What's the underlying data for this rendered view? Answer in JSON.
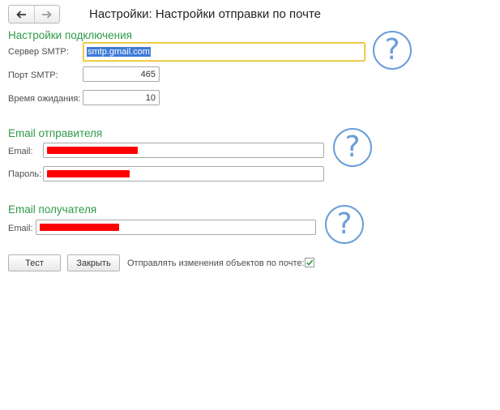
{
  "page": {
    "title": "Настройки: Настройки отправки по почте"
  },
  "nav": {
    "back_icon": "arrow-left-icon",
    "forward_icon": "arrow-right-icon"
  },
  "connection": {
    "title": "Настройки подключения",
    "smtp_server_label": "Сервер SMTP:",
    "smtp_server_value": "smtp.gmail.com",
    "smtp_port_label": "Порт SMTP:",
    "smtp_port_value": "465",
    "timeout_label": "Время ожидания:",
    "timeout_value": "10",
    "help_icon": "question-circle-icon"
  },
  "sender": {
    "title": "Email отправителя",
    "email_label": "Email:",
    "password_label": "Пароль:",
    "email_value_state": "redacted",
    "password_value_state": "redacted",
    "help_icon": "question-circle-icon"
  },
  "recipient": {
    "title": "Email получателя",
    "email_label": "Email:",
    "email_value_state": "redacted",
    "help_icon": "question-circle-icon"
  },
  "footer": {
    "test_button": "Тест",
    "close_button": "Закрыть",
    "send_changes_label": "Отправлять изменения объектов по почте:",
    "send_changes_checked": true
  },
  "colors": {
    "section_title": "#2f9a4a",
    "help_icon": "#6a9ed8",
    "focus_border": "#e8c02a",
    "selection": "#3d79d6",
    "redaction": "#ff0000",
    "checkmark": "#2aa23a"
  }
}
